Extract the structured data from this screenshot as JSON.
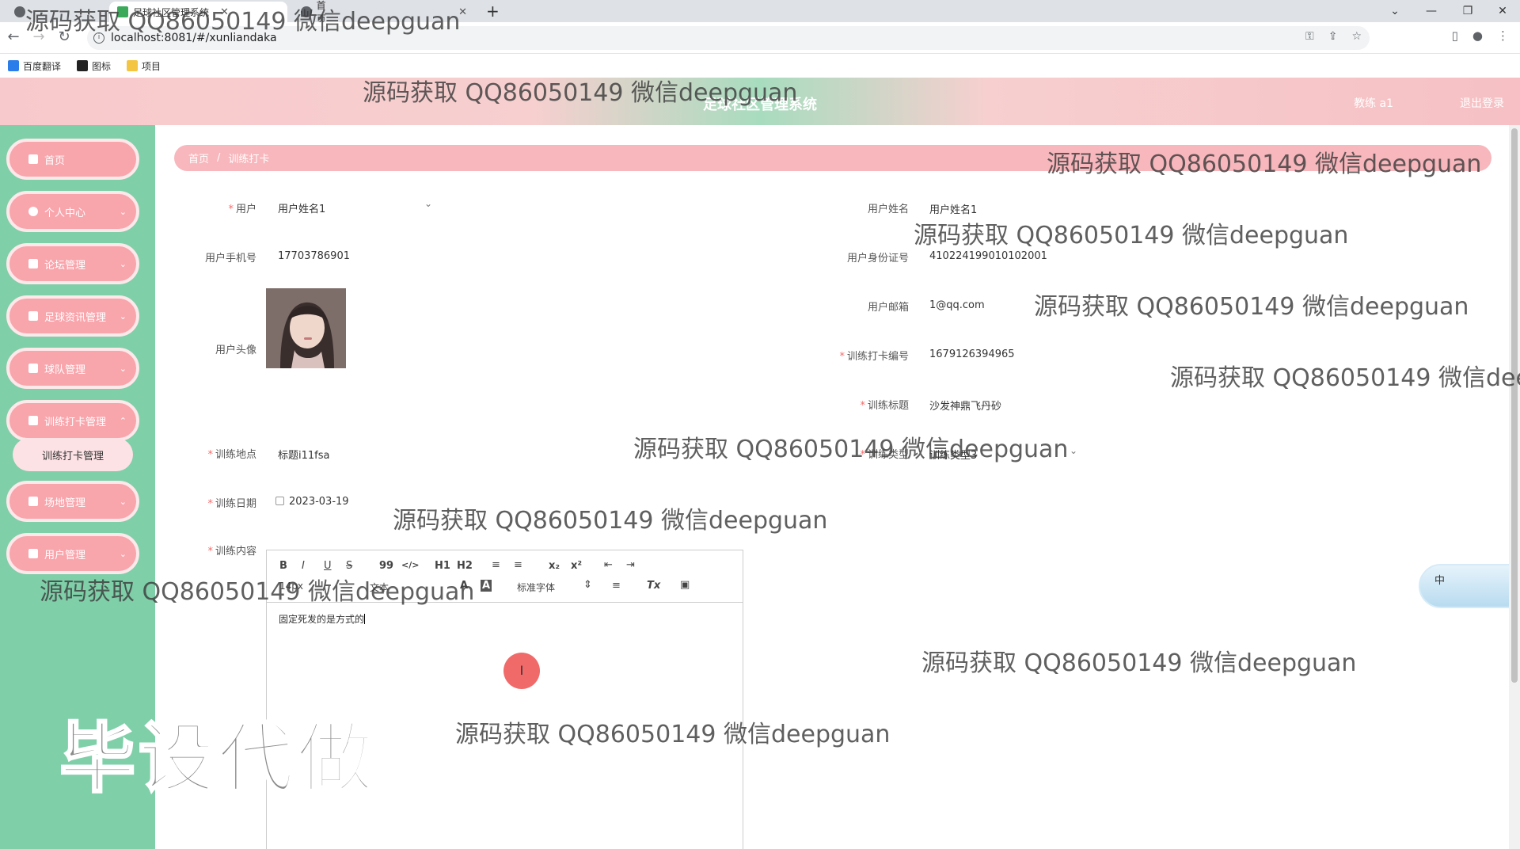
{
  "browser": {
    "tabs": [
      {
        "title": ""
      },
      {
        "title": "足球社区管理系统"
      },
      {
        "title": "首页"
      }
    ],
    "url": "localhost:8081/#/xunliandaka",
    "bookmarks": [
      "百度翻译",
      "图标",
      "项目"
    ]
  },
  "header": {
    "title": "足球社区管理系统",
    "user": "教练 a1",
    "logout": "退出登录"
  },
  "sidebar": {
    "items": [
      {
        "label": "首页",
        "icon": "home-icon"
      },
      {
        "label": "个人中心",
        "icon": "user-icon"
      },
      {
        "label": "论坛管理",
        "icon": "grid-icon"
      },
      {
        "label": "足球资讯管理",
        "icon": "grid-icon"
      },
      {
        "label": "球队管理",
        "icon": "clipboard-icon"
      },
      {
        "label": "训练打卡管理",
        "icon": "chart-icon"
      },
      {
        "label": "场地管理",
        "icon": "grid-icon"
      },
      {
        "label": "用户管理",
        "icon": "grid-icon"
      }
    ],
    "submenu": {
      "label": "训练打卡管理"
    }
  },
  "breadcrumb": {
    "home": "首页",
    "sep": "/",
    "current": "训练打卡"
  },
  "form": {
    "user_label": "用户",
    "user_value": "用户姓名1",
    "user_name_label": "用户姓名",
    "user_name_value": "用户姓名1",
    "phone_label": "用户手机号",
    "phone_value": "17703786901",
    "id_label": "用户身份证号",
    "id_value": "410224199010102001",
    "avatar_label": "用户头像",
    "email_label": "用户邮箱",
    "email_value": "1@qq.com",
    "code_label": "训练打卡编号",
    "code_value": "1679126394965",
    "title_label": "训练标题",
    "title_value": "沙发神鼎飞丹砂",
    "place_label": "训练地点",
    "place_value": "标题i11fsa",
    "type_label": "训练类型",
    "type_value": "训练类型3",
    "date_label": "训练日期",
    "date_value": "2023-03-19",
    "content_label": "训练内容",
    "content_value": "固定死发的是方式的"
  },
  "editor": {
    "toolbar": {
      "bold": "B",
      "italic": "I",
      "underline": "U",
      "strike": "S",
      "quote": "99",
      "code": "</>",
      "h1": "H1",
      "h2": "H2",
      "ol": "≡",
      "ul": "≡",
      "sub": "x₂",
      "sup": "x²",
      "outdent": "⇤",
      "indent": "⇥",
      "size": "14px",
      "header": "文本",
      "color": "A",
      "bg": "A",
      "font": "标准字体",
      "align": "≡",
      "clean": "Tx",
      "image": "▣"
    }
  },
  "floater": {
    "label": "中"
  },
  "watermarks": [
    "源码获取 QQ86050149 微信deepguan",
    "源码获取 QQ86050149 微信deepguan",
    "源码获取 QQ86050149 微信deepguan",
    "源码获取 QQ86050149 微信deepguan",
    "源码获取 QQ86050149 微信deepguan",
    "源码获取 QQ86050149 微信dee",
    "源码获取 QQ86050149 微信deepguan",
    "源码获取 QQ86050149 微信deepguan",
    "源码获取 QQ86050149 微信deepguan",
    "源码获取 QQ86050149 微信deepguan",
    "源码获取 QQ86050149 微信deepguan"
  ],
  "big_watermark": "毕设代做"
}
